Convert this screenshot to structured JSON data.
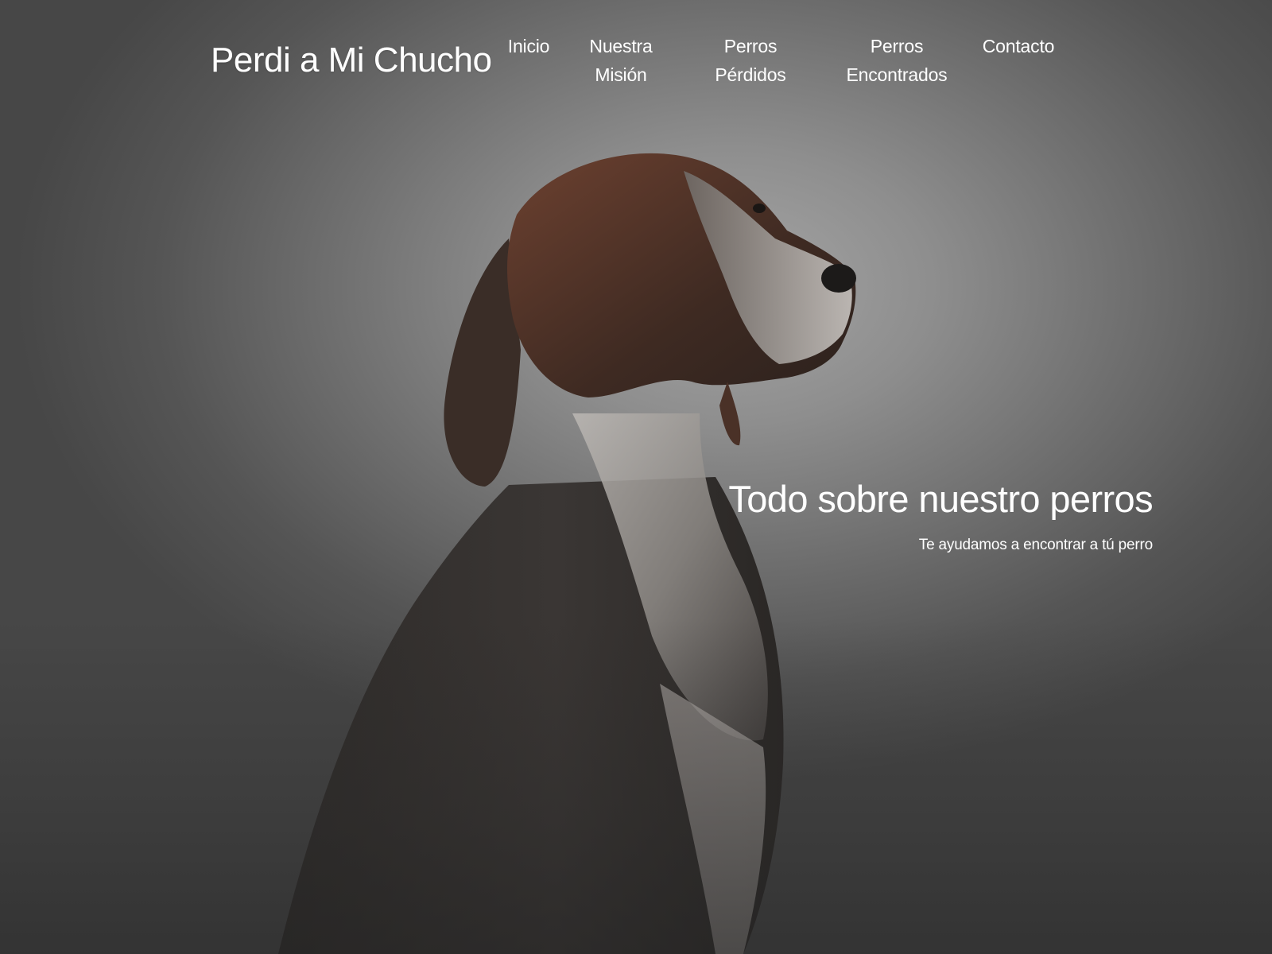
{
  "site": {
    "brand": "Perdi a Mi Chucho"
  },
  "nav": {
    "items": [
      {
        "line1": "Inicio",
        "line2": ""
      },
      {
        "line1": "Nuestra",
        "line2": "Misión"
      },
      {
        "line1": "Perros",
        "line2": "Pérdidos"
      },
      {
        "line1": "Perros",
        "line2": "Encontrados"
      },
      {
        "line1": "Contacto",
        "line2": ""
      }
    ]
  },
  "hero": {
    "title": "Todo sobre nuestro perros",
    "subtitle": "Te ayudamos a encontrar a tú perro",
    "image_subject": "dog-portrait"
  }
}
